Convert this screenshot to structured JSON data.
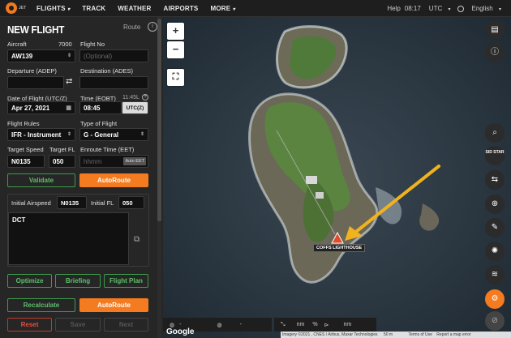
{
  "app": {
    "logo_text": "JET"
  },
  "nav": {
    "items": [
      {
        "label": "FLIGHTS",
        "caret": "▾"
      },
      {
        "label": "TRACK",
        "caret": ""
      },
      {
        "label": "WEATHER",
        "caret": ""
      },
      {
        "label": "AIRPORTS",
        "caret": ""
      },
      {
        "label": "MORE",
        "caret": "▾"
      }
    ]
  },
  "topright": {
    "help": "Help",
    "time": "08:17",
    "tz": "UTC",
    "tz_caret": "▾",
    "lang": "English",
    "lang_caret": "▾"
  },
  "panel": {
    "title": "NEW FLIGHT",
    "route_label": "Route",
    "info": "i"
  },
  "form": {
    "aircraft_label": "Aircraft",
    "aircraft_count": "7000",
    "aircraft_value": "AW139",
    "flightno_label": "Flight No",
    "flightno_placeholder": "(Optional)",
    "adep_label": "Departure (ADEP)",
    "ades_label": "Destination (ADES)",
    "swap": "⇄",
    "date_label": "Date of Flight (UTC/Z)",
    "date_value": "Apr 27, 2021",
    "time_label": "Time (EOBT)",
    "time_local": "11:45L",
    "time_help": "?",
    "time_value": "08:45",
    "time_zone": "UTC(Z)",
    "rules_label": "Flight Rules",
    "rules_value": "IFR - Instrument",
    "type_label": "Type of Flight",
    "type_value": "G - General",
    "speed_label": "Target Speed",
    "speed_value": "N0135",
    "fl_label": "Target FL",
    "fl_value": "050",
    "eet_label": "Enroute Time (EET)",
    "eet_placeholder": "hhmm",
    "eet_auto": "Auto EET"
  },
  "buttons": {
    "validate": "Validate",
    "autoroute": "AutoRoute",
    "optimize": "Optimize",
    "briefing": "Briefing",
    "flightplan": "Flight Plan",
    "recalculate": "Recalculate",
    "autoroute2": "AutoRoute",
    "reset": "Reset",
    "save": "Save",
    "next": "Next"
  },
  "route_box": {
    "ias_label": "Initial Airspeed",
    "ias_value": "N0135",
    "ifl_label": "Initial FL",
    "ifl_value": "050",
    "route_text": "DCT"
  },
  "map": {
    "zoom_in": "+",
    "zoom_out": "−",
    "fullscreen": "⛶",
    "marker_label": "COFFS LIGHTHOUSE",
    "sid_star": "SID STAR",
    "google": "Google"
  },
  "bottombar": {
    "unit1": "nm",
    "unit2": "%",
    "unit3": "nm",
    "dash1": "-",
    "dash2": "-"
  },
  "attribution": {
    "imagery": "Imagery ©2021 , CNES / Airbus, Maxar Technologies",
    "scale": "50 m",
    "terms": "Terms of Use",
    "report": "Report a map error"
  }
}
